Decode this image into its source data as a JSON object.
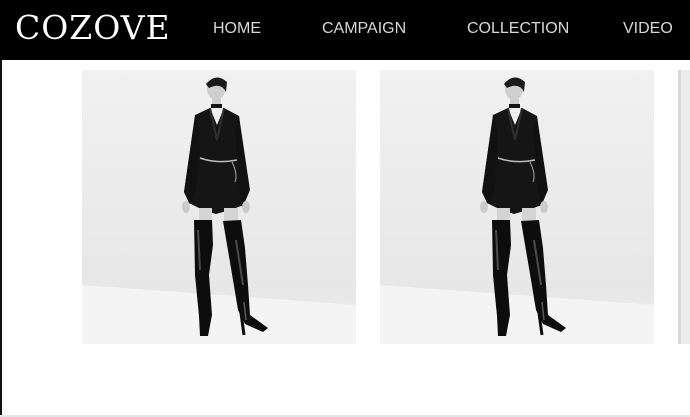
{
  "brand": {
    "logo_text": "COZOVE"
  },
  "nav": {
    "items": [
      {
        "label": "HOME"
      },
      {
        "label": "CAMPAIGN"
      },
      {
        "label": "COLLECTION"
      },
      {
        "label": "VIDEO"
      }
    ]
  },
  "gallery": {
    "photos": [
      {
        "subject": "model-in-black-blazer-and-patent-thigh-high-boots"
      },
      {
        "subject": "model-in-black-blazer-and-patent-thigh-high-boots"
      },
      {
        "subject": "partial-next-photo"
      }
    ]
  },
  "colors": {
    "header_bg": "#000000",
    "nav_text": "#d8d8d8",
    "photo_bg": "#ececec"
  }
}
